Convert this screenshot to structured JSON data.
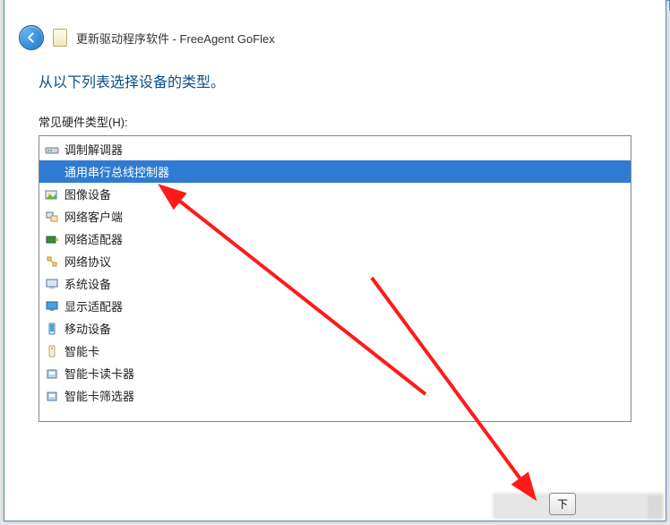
{
  "window": {
    "title": "更新驱动程序软件 - FreeAgent GoFlex",
    "close_glyph": "✕"
  },
  "heading": "从以下列表选择设备的类型。",
  "section_label": "常见硬件类型(H):",
  "devices": [
    {
      "icon": "modem-icon",
      "label": "调制解调器",
      "selected": false
    },
    {
      "icon": "usb-icon",
      "label": "通用串行总线控制器",
      "selected": true
    },
    {
      "icon": "image-icon",
      "label": "图像设备",
      "selected": false
    },
    {
      "icon": "netclient-icon",
      "label": "网络客户端",
      "selected": false
    },
    {
      "icon": "netadapter-icon",
      "label": "网络适配器",
      "selected": false
    },
    {
      "icon": "netproto-icon",
      "label": "网络协议",
      "selected": false
    },
    {
      "icon": "system-icon",
      "label": "系统设备",
      "selected": false
    },
    {
      "icon": "display-icon",
      "label": "显示适配器",
      "selected": false
    },
    {
      "icon": "mobile-icon",
      "label": "移动设备",
      "selected": false
    },
    {
      "icon": "smartcard-icon",
      "label": "智能卡",
      "selected": false
    },
    {
      "icon": "reader-icon",
      "label": "智能卡读卡器",
      "selected": false
    },
    {
      "icon": "filter-icon",
      "label": "智能卡筛选器",
      "selected": false
    }
  ],
  "buttons": {
    "next": "下"
  }
}
